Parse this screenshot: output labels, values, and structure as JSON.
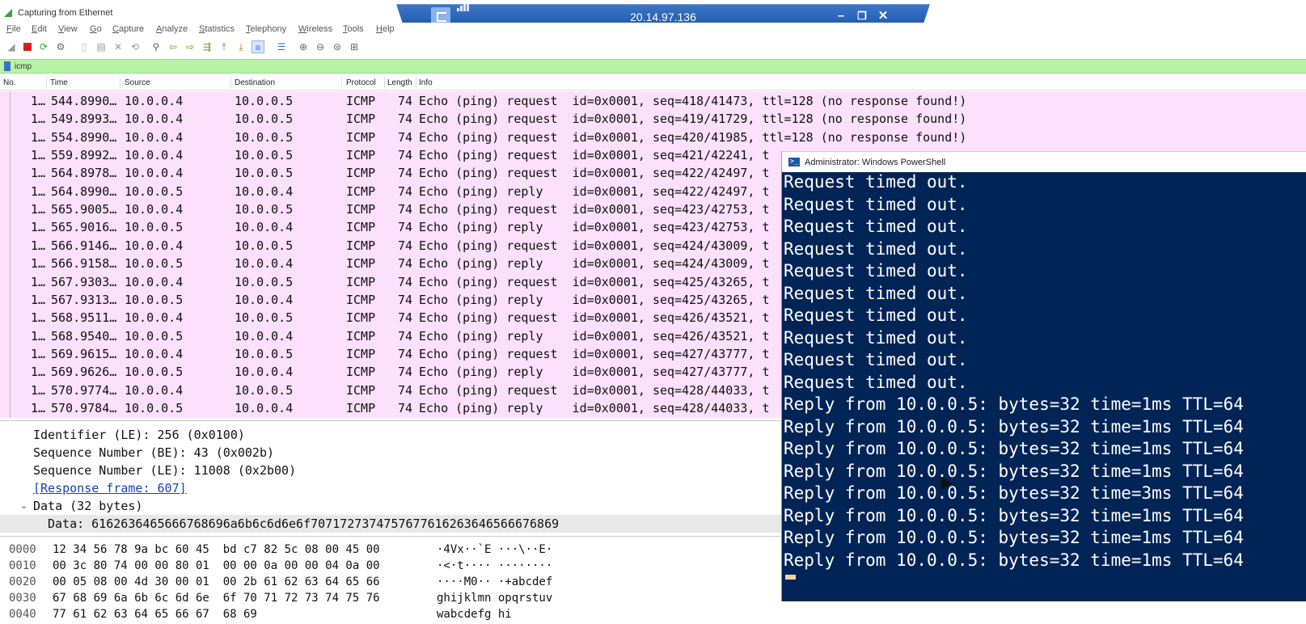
{
  "window": {
    "title": "Capturing from Ethernet"
  },
  "remote": {
    "ip": "20.14.97.136",
    "minimize": "–",
    "restore": "❐",
    "close": "✕"
  },
  "menu": [
    "File",
    "Edit",
    "View",
    "Go",
    "Capture",
    "Analyze",
    "Statistics",
    "Telephony",
    "Wireless",
    "Tools",
    "Help"
  ],
  "filter": {
    "value": "icmp"
  },
  "columns": [
    "No.",
    "Time",
    "Source",
    "Destination",
    "Protocol",
    "Length",
    "Info"
  ],
  "packets": [
    {
      "no": "1…",
      "time": "544.8990…",
      "src": "10.0.0.4",
      "dst": "10.0.0.5",
      "proto": "ICMP",
      "len": "74",
      "info": "Echo (ping) request  id=0x0001, seq=418/41473, ttl=128 (no response found!)"
    },
    {
      "no": "1…",
      "time": "549.8993…",
      "src": "10.0.0.4",
      "dst": "10.0.0.5",
      "proto": "ICMP",
      "len": "74",
      "info": "Echo (ping) request  id=0x0001, seq=419/41729, ttl=128 (no response found!)"
    },
    {
      "no": "1…",
      "time": "554.8990…",
      "src": "10.0.0.4",
      "dst": "10.0.0.5",
      "proto": "ICMP",
      "len": "74",
      "info": "Echo (ping) request  id=0x0001, seq=420/41985, ttl=128 (no response found!)"
    },
    {
      "no": "1…",
      "time": "559.8992…",
      "src": "10.0.0.4",
      "dst": "10.0.0.5",
      "proto": "ICMP",
      "len": "74",
      "info": "Echo (ping) request  id=0x0001, seq=421/42241, t"
    },
    {
      "no": "1…",
      "time": "564.8978…",
      "src": "10.0.0.4",
      "dst": "10.0.0.5",
      "proto": "ICMP",
      "len": "74",
      "info": "Echo (ping) request  id=0x0001, seq=422/42497, t"
    },
    {
      "no": "1…",
      "time": "564.8990…",
      "src": "10.0.0.5",
      "dst": "10.0.0.4",
      "proto": "ICMP",
      "len": "74",
      "info": "Echo (ping) reply    id=0x0001, seq=422/42497, t"
    },
    {
      "no": "1…",
      "time": "565.9005…",
      "src": "10.0.0.4",
      "dst": "10.0.0.5",
      "proto": "ICMP",
      "len": "74",
      "info": "Echo (ping) request  id=0x0001, seq=423/42753, t"
    },
    {
      "no": "1…",
      "time": "565.9016…",
      "src": "10.0.0.5",
      "dst": "10.0.0.4",
      "proto": "ICMP",
      "len": "74",
      "info": "Echo (ping) reply    id=0x0001, seq=423/42753, t"
    },
    {
      "no": "1…",
      "time": "566.9146…",
      "src": "10.0.0.4",
      "dst": "10.0.0.5",
      "proto": "ICMP",
      "len": "74",
      "info": "Echo (ping) request  id=0x0001, seq=424/43009, t"
    },
    {
      "no": "1…",
      "time": "566.9158…",
      "src": "10.0.0.5",
      "dst": "10.0.0.4",
      "proto": "ICMP",
      "len": "74",
      "info": "Echo (ping) reply    id=0x0001, seq=424/43009, t"
    },
    {
      "no": "1…",
      "time": "567.9303…",
      "src": "10.0.0.4",
      "dst": "10.0.0.5",
      "proto": "ICMP",
      "len": "74",
      "info": "Echo (ping) request  id=0x0001, seq=425/43265, t"
    },
    {
      "no": "1…",
      "time": "567.9313…",
      "src": "10.0.0.5",
      "dst": "10.0.0.4",
      "proto": "ICMP",
      "len": "74",
      "info": "Echo (ping) reply    id=0x0001, seq=425/43265, t"
    },
    {
      "no": "1…",
      "time": "568.9511…",
      "src": "10.0.0.4",
      "dst": "10.0.0.5",
      "proto": "ICMP",
      "len": "74",
      "info": "Echo (ping) request  id=0x0001, seq=426/43521, t"
    },
    {
      "no": "1…",
      "time": "568.9540…",
      "src": "10.0.0.5",
      "dst": "10.0.0.4",
      "proto": "ICMP",
      "len": "74",
      "info": "Echo (ping) reply    id=0x0001, seq=426/43521, t"
    },
    {
      "no": "1…",
      "time": "569.9615…",
      "src": "10.0.0.4",
      "dst": "10.0.0.5",
      "proto": "ICMP",
      "len": "74",
      "info": "Echo (ping) request  id=0x0001, seq=427/43777, t"
    },
    {
      "no": "1…",
      "time": "569.9626…",
      "src": "10.0.0.5",
      "dst": "10.0.0.4",
      "proto": "ICMP",
      "len": "74",
      "info": "Echo (ping) reply    id=0x0001, seq=427/43777, t"
    },
    {
      "no": "1…",
      "time": "570.9774…",
      "src": "10.0.0.4",
      "dst": "10.0.0.5",
      "proto": "ICMP",
      "len": "74",
      "info": "Echo (ping) request  id=0x0001, seq=428/44033, t"
    },
    {
      "no": "1…",
      "time": "570.9784…",
      "src": "10.0.0.5",
      "dst": "10.0.0.4",
      "proto": "ICMP",
      "len": "74",
      "info": "Echo (ping) reply    id=0x0001, seq=428/44033, t"
    }
  ],
  "details": {
    "identifier": "Identifier (LE): 256 (0x0100)",
    "seq_be": "Sequence Number (BE): 43 (0x002b)",
    "seq_le": "Sequence Number (LE): 11008 (0x2b00)",
    "response_frame": "[Response frame: 607]",
    "data_header": "Data (32 bytes)",
    "data": "Data: 6162636465666768696a6b6c6d6e6f7071727374757677616263646566676869"
  },
  "hex": [
    {
      "off": "0000",
      "bytes": "12 34 56 78 9a bc 60 45  bd c7 82 5c 08 00 45 00",
      "ascii": "·4Vx··`E ···\\··E·"
    },
    {
      "off": "0010",
      "bytes": "00 3c 80 74 00 00 80 01  00 00 0a 00 00 04 0a 00",
      "ascii": "·<·t···· ········"
    },
    {
      "off": "0020",
      "bytes": "00 05 08 00 4d 30 00 01  00 2b 61 62 63 64 65 66",
      "ascii": "····M0·· ·+abcdef"
    },
    {
      "off": "0030",
      "bytes": "67 68 69 6a 6b 6c 6d 6e  6f 70 71 72 73 74 75 76",
      "ascii": "ghijklmn opqrstuv"
    },
    {
      "off": "0040",
      "bytes": "77 61 62 63 64 65 66 67  68 69",
      "ascii": "wabcdefg hi"
    }
  ],
  "powershell": {
    "title": "Administrator: Windows PowerShell",
    "lines": [
      "Request timed out.",
      "Request timed out.",
      "Request timed out.",
      "Request timed out.",
      "Request timed out.",
      "Request timed out.",
      "Request timed out.",
      "Request timed out.",
      "Request timed out.",
      "Request timed out.",
      "Reply from 10.0.0.5: bytes=32 time=1ms TTL=64",
      "Reply from 10.0.0.5: bytes=32 time=1ms TTL=64",
      "Reply from 10.0.0.5: bytes=32 time=1ms TTL=64",
      "Reply from 10.0.0.5: bytes=32 time=1ms TTL=64",
      "Reply from 10.0.0.5: bytes=32 time=3ms TTL=64",
      "Reply from 10.0.0.5: bytes=32 time=1ms TTL=64",
      "Reply from 10.0.0.5: bytes=32 time=1ms TTL=64",
      "Reply from 10.0.0.5: bytes=32 time=1ms TTL=64"
    ]
  },
  "colors": {
    "packet_row": "#fce0fc",
    "filter_bg": "#b7f3a5",
    "powershell_bg": "#012456",
    "rd_bar": "#2a64b8"
  }
}
